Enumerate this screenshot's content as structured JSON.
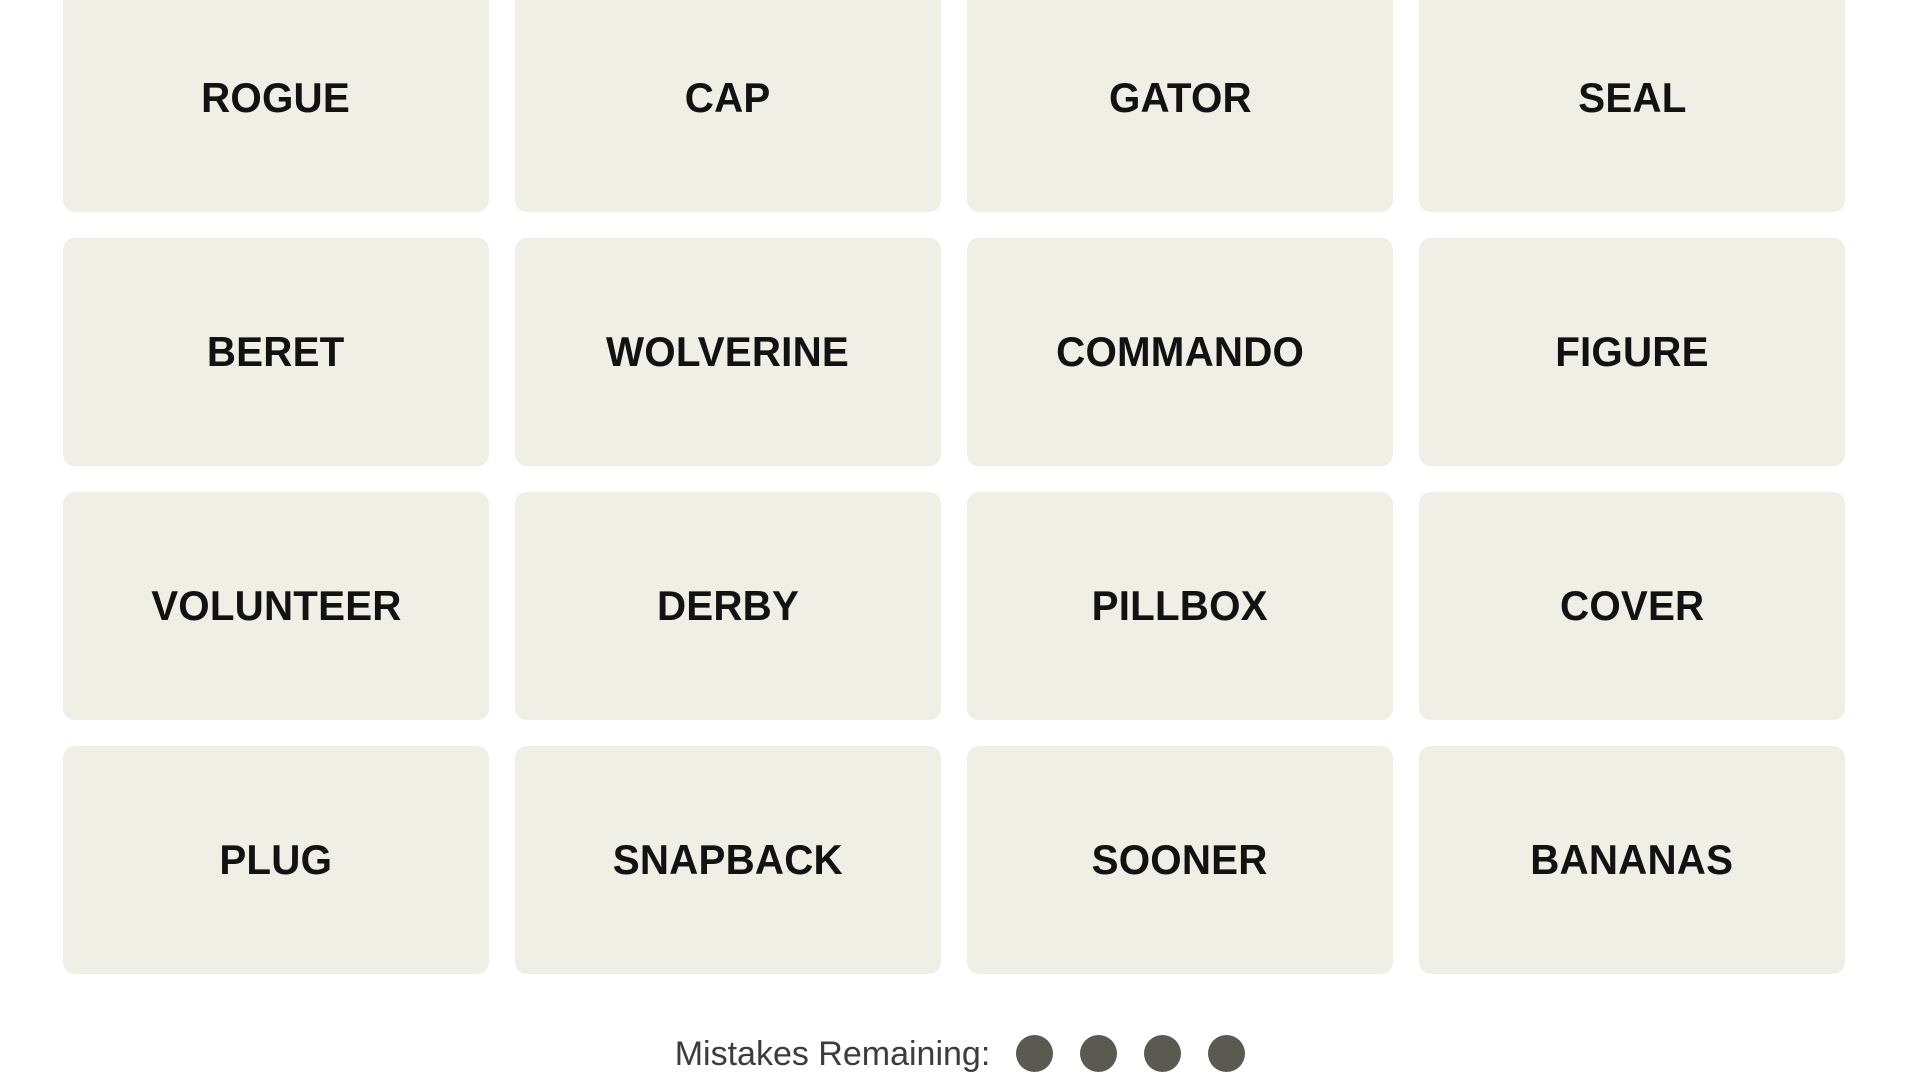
{
  "board": {
    "columns": 4,
    "rows": 4,
    "tile_color": "#efefe6",
    "tile_text_color": "#121212",
    "page_background": "#ffffff",
    "tiles": [
      {
        "label": "ROGUE"
      },
      {
        "label": "CAP"
      },
      {
        "label": "GATOR"
      },
      {
        "label": "SEAL"
      },
      {
        "label": "BERET"
      },
      {
        "label": "WOLVERINE"
      },
      {
        "label": "COMMANDO"
      },
      {
        "label": "FIGURE"
      },
      {
        "label": "VOLUNTEER"
      },
      {
        "label": "DERBY"
      },
      {
        "label": "PILLBOX"
      },
      {
        "label": "COVER"
      },
      {
        "label": "PLUG"
      },
      {
        "label": "SNAPBACK"
      },
      {
        "label": "SOONER"
      },
      {
        "label": "BANANAS"
      }
    ]
  },
  "mistakes": {
    "label": "Mistakes Remaining:",
    "remaining": 4,
    "dot_color": "#5a5a50",
    "dots": [
      {
        "name": "mistake-dot-1"
      },
      {
        "name": "mistake-dot-2"
      },
      {
        "name": "mistake-dot-3"
      },
      {
        "name": "mistake-dot-4"
      }
    ]
  },
  "ghost_row": {
    "cells": [
      "",
      "",
      "",
      ""
    ]
  }
}
